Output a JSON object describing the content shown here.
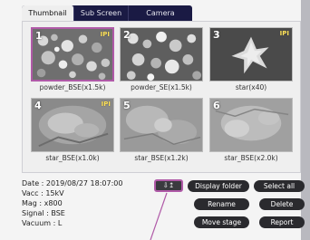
{
  "tabs": [
    {
      "label": "Thumbnail",
      "active": true
    },
    {
      "label": "Sub Screen",
      "active": false
    },
    {
      "label": "Camera",
      "active": false
    }
  ],
  "thumbnails": [
    {
      "number": "1",
      "caption": "powder_BSE(x1.5k)",
      "badge": "IPI",
      "selected": true
    },
    {
      "number": "2",
      "caption": "powder_SE(x1.5k)",
      "badge": "",
      "selected": false
    },
    {
      "number": "3",
      "caption": "star(x40)",
      "badge": "IPI",
      "selected": false
    },
    {
      "number": "4",
      "caption": "star_BSE(x1.0k)",
      "badge": "IPI",
      "selected": false
    },
    {
      "number": "5",
      "caption": "star_BSE(x1.2k)",
      "badge": "",
      "selected": false
    },
    {
      "number": "6",
      "caption": "star_BSE(x2.0k)",
      "badge": "",
      "selected": false
    }
  ],
  "info": {
    "date": "Date : 2019/08/27 18:07:00",
    "vacc": "Vacc : 15kV",
    "mag": "Mag : x800",
    "signal": "Signal : BSE",
    "vacuum": "Vacuum : L"
  },
  "buttons": {
    "export": "⇩↥",
    "display_folder": "Display folder",
    "select_all": "Select all",
    "rename": "Rename",
    "delete": "Delete",
    "move_stage": "Move stage",
    "report": "Report"
  },
  "colors": {
    "tab_bar": "#1a1a44",
    "selection": "#b05aa8",
    "button": "#2a2a2e",
    "badge": "#ffe25a"
  }
}
